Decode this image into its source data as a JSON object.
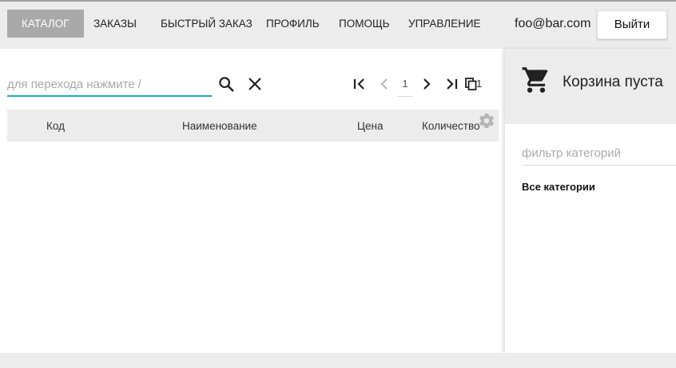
{
  "nav": {
    "items": [
      {
        "label": "КАТАЛОГ",
        "active": true
      },
      {
        "label": "ЗАКАЗЫ",
        "active": false
      },
      {
        "label": "БЫСТРЫЙ ЗАКАЗ",
        "active": false
      },
      {
        "label": "ПРОФИЛЬ",
        "active": false
      },
      {
        "label": "ПОМОЩЬ",
        "active": false
      },
      {
        "label": "УПРАВЛЕНИЕ",
        "active": false
      }
    ],
    "user_email": "foo@bar.com",
    "logout_label": "Выйти"
  },
  "search": {
    "placeholder": "для перехода нажмите /",
    "value": ""
  },
  "pagination": {
    "current_page": "1",
    "total_pages": "1"
  },
  "table": {
    "columns": [
      "Код",
      "Наименование",
      "Цена",
      "Количество"
    ],
    "rows": []
  },
  "cart": {
    "status": "Корзина пуста"
  },
  "categories": {
    "filter_placeholder": "фильтр категорий",
    "items": [
      "Все категории"
    ]
  },
  "colors": {
    "accent": "#26a7b3",
    "active_nav": "#a9a9a9",
    "bar_bg": "#ececec"
  }
}
